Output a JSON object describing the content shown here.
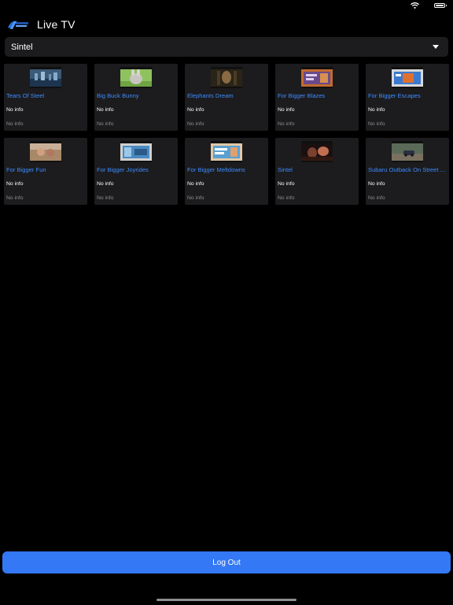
{
  "header": {
    "title": "Live TV",
    "logo_icon": "streaming-logo-icon"
  },
  "selector": {
    "value": "Sintel",
    "icon": "chevron-down-icon"
  },
  "cards": [
    {
      "title": "Tears Of Steel",
      "info1": "No info",
      "info2": "No info"
    },
    {
      "title": "Big Buck Bunny",
      "info1": "No info",
      "info2": "No info"
    },
    {
      "title": "Elephants Dream",
      "info1": "No info",
      "info2": "No info"
    },
    {
      "title": "For Bigger Blazes",
      "info1": "No info",
      "info2": "No info"
    },
    {
      "title": "For Bigger Escapes",
      "info1": "No info",
      "info2": "No info"
    },
    {
      "title": "For Bigger Fun",
      "info1": "No info",
      "info2": "No info"
    },
    {
      "title": "For Bigger Joyrides",
      "info1": "No info",
      "info2": "No info"
    },
    {
      "title": "For Bigger Meltdowns",
      "info1": "No info",
      "info2": "No info"
    },
    {
      "title": "Sintel",
      "info1": "No info",
      "info2": "No info"
    },
    {
      "title": "Subaru Outback On Street And Dirt",
      "info1": "No info",
      "info2": "No info"
    }
  ],
  "footer": {
    "logout_label": "Log Out"
  },
  "colors": {
    "background": "#000000",
    "card": "#1c1c1e",
    "link": "#3d8bff",
    "accent": "#3478f6",
    "muted": "#8e8e93"
  }
}
